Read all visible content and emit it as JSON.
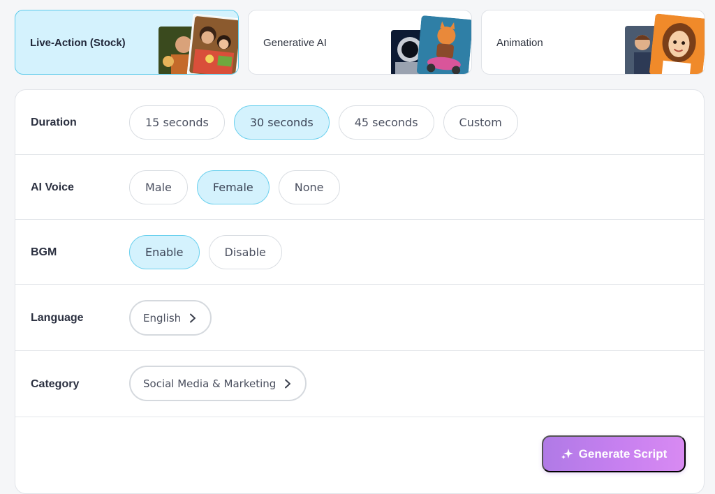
{
  "style_cards": [
    {
      "label": "Live-Action (Stock)",
      "thumb": "family-meal-photo"
    },
    {
      "label": "Generative AI",
      "thumb": "astronaut-and-cat-scooter-art"
    },
    {
      "label": "Animation",
      "thumb": "cartoon-woman-character"
    }
  ],
  "rows": {
    "duration": {
      "label": "Duration",
      "options": [
        "15 seconds",
        "30 seconds",
        "45 seconds",
        "Custom"
      ],
      "selected": "30 seconds"
    },
    "voice": {
      "label": "AI Voice",
      "options": [
        "Male",
        "Female",
        "None"
      ],
      "selected": "Female"
    },
    "bgm": {
      "label": "BGM",
      "options": [
        "Enable",
        "Disable"
      ],
      "selected": "Enable"
    },
    "language": {
      "label": "Language",
      "value": "English"
    },
    "category": {
      "label": "Category",
      "value": "Social Media & Marketing"
    }
  },
  "generate": {
    "label": "Generate Script",
    "icon": "sparkle-icon"
  },
  "colors": {
    "accent_bg": "#d4f2fd",
    "accent_border": "#5dcbeb",
    "button_gradient_start": "#b07ae6",
    "button_gradient_end": "#d88af2"
  }
}
